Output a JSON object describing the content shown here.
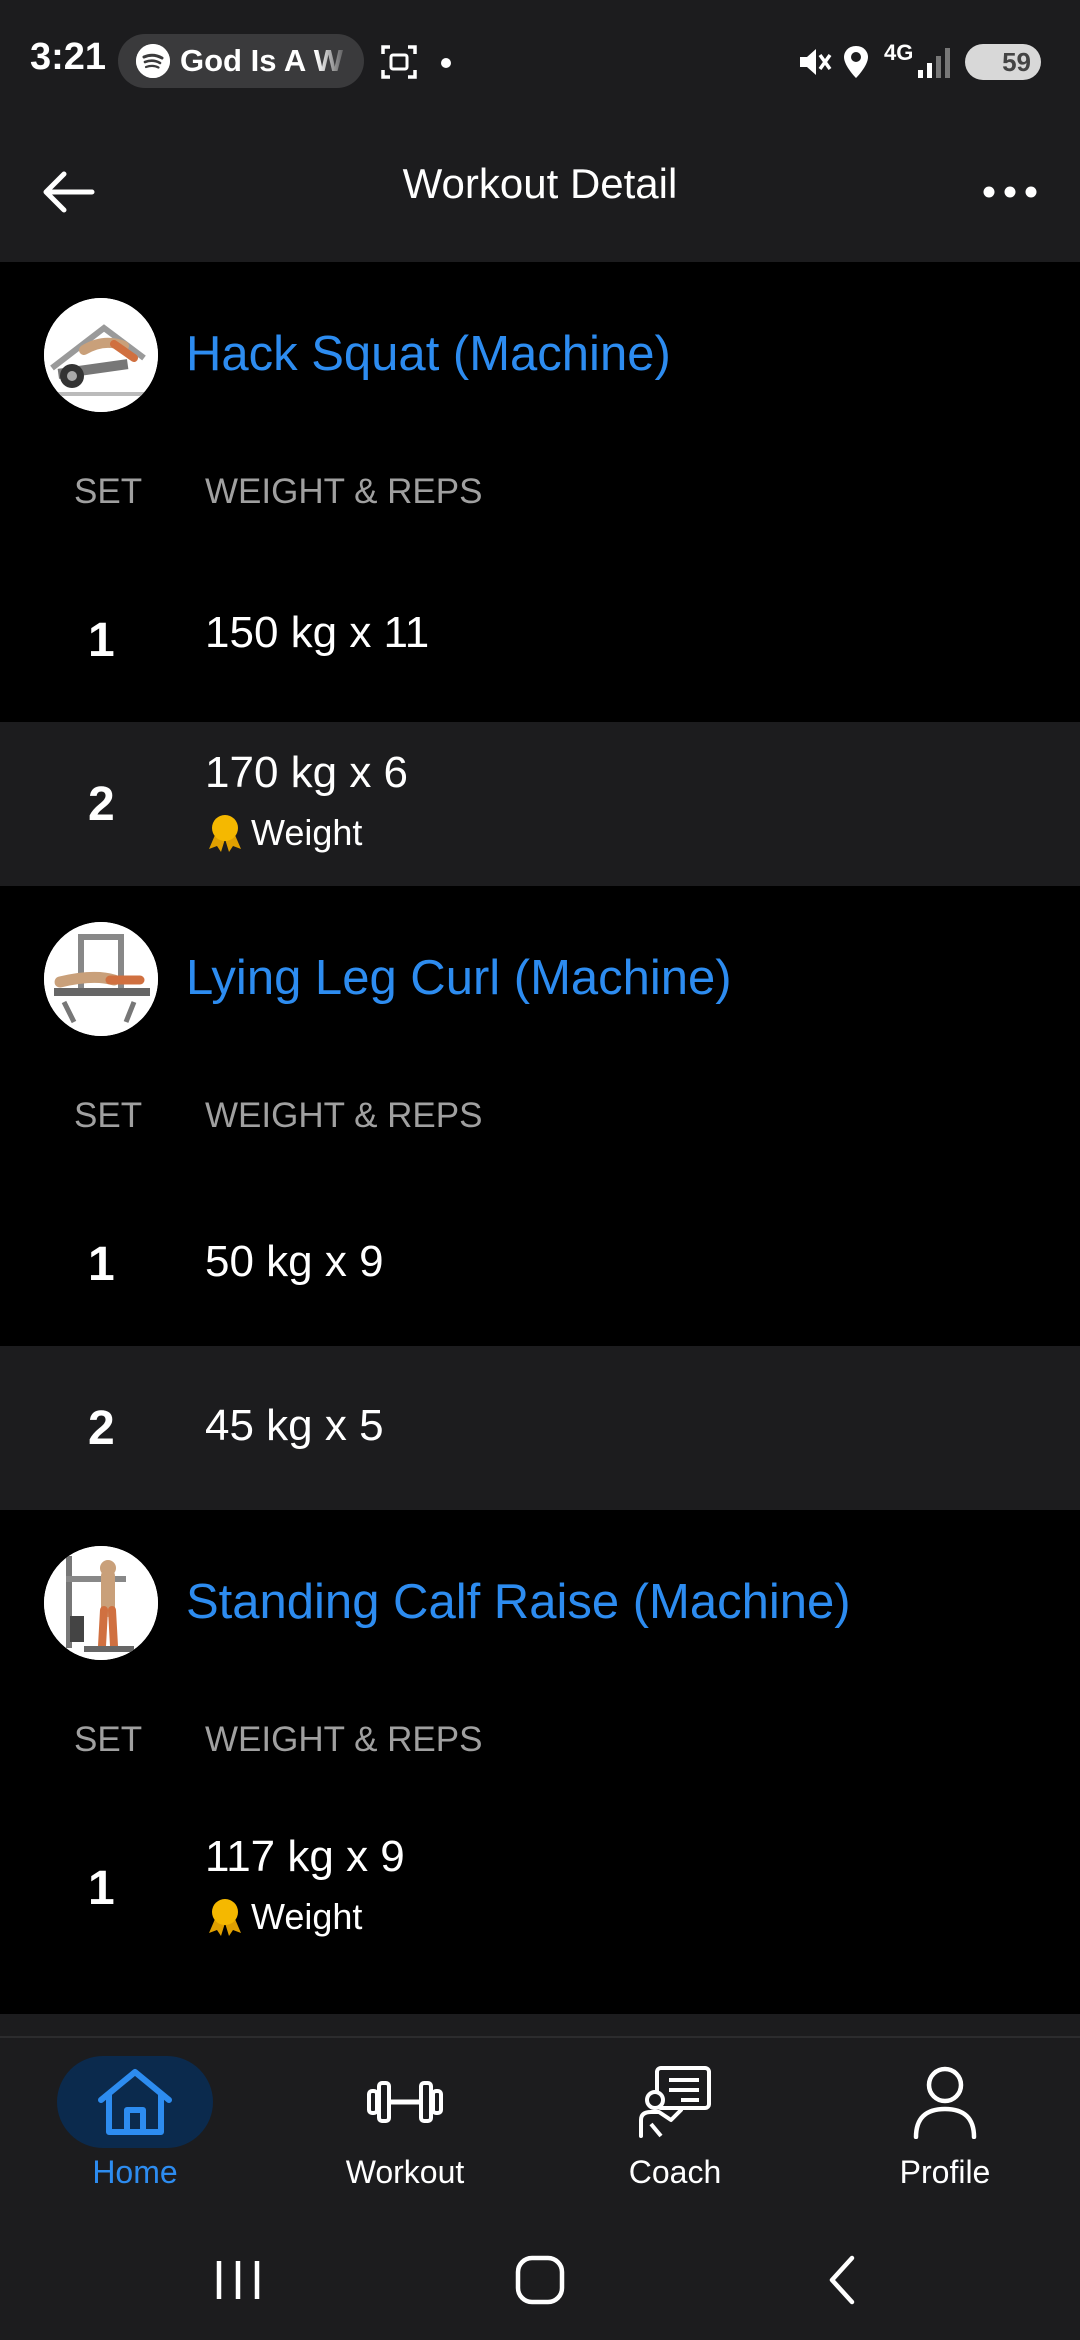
{
  "status_bar": {
    "time": "3:21",
    "media_pill_text": "God Is A W",
    "network": "4G",
    "battery": "59"
  },
  "app_bar": {
    "title": "Workout Detail"
  },
  "columns": {
    "set": "SET",
    "weight_reps": "WEIGHT & REPS"
  },
  "exercises": [
    {
      "name": "Hack Squat (Machine)",
      "sets": [
        {
          "num": "1",
          "value": "150 kg x 11",
          "badge": ""
        },
        {
          "num": "2",
          "value": "170 kg x 6",
          "badge": "Weight"
        }
      ]
    },
    {
      "name": "Lying Leg Curl (Machine)",
      "sets": [
        {
          "num": "1",
          "value": "50 kg x 9",
          "badge": ""
        },
        {
          "num": "2",
          "value": "45 kg x 5",
          "badge": ""
        }
      ]
    },
    {
      "name": "Standing Calf Raise (Machine)",
      "sets": [
        {
          "num": "1",
          "value": "117 kg x 9",
          "badge": "Weight"
        }
      ]
    }
  ],
  "bottom_nav": [
    {
      "label": "Home",
      "icon": "home-icon",
      "active": true
    },
    {
      "label": "Workout",
      "icon": "dumbbell-icon",
      "active": false
    },
    {
      "label": "Coach",
      "icon": "coach-icon",
      "active": false
    },
    {
      "label": "Profile",
      "icon": "profile-icon",
      "active": false
    }
  ],
  "colors": {
    "accent": "#2d8cf0",
    "surface": "#1c1c1e",
    "background": "#000000",
    "medal": "#f5b800"
  }
}
